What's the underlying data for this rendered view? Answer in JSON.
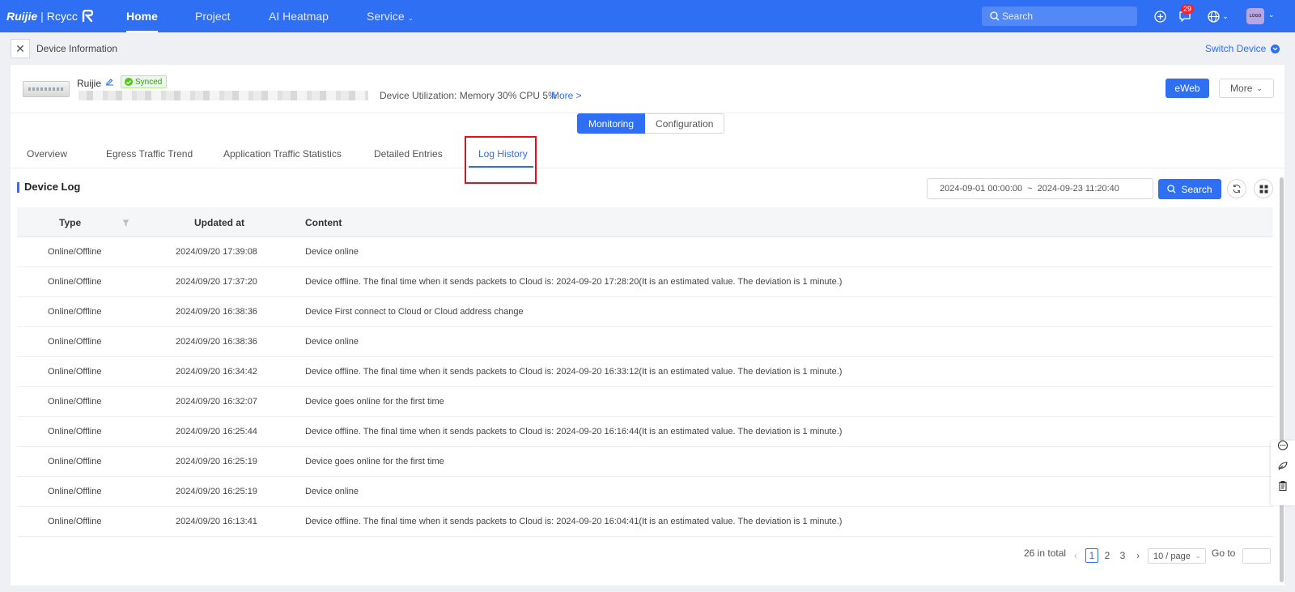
{
  "nav": {
    "logo_brand": "Ruijie",
    "logo_sep": "|",
    "logo_brand2": "Rcycc",
    "items": [
      {
        "label": "Home",
        "active": true
      },
      {
        "label": "Project",
        "active": false
      },
      {
        "label": "AI Heatmap",
        "active": false
      },
      {
        "label": "Service",
        "active": false
      }
    ],
    "search_placeholder": "Search",
    "message_count": "29",
    "avatar_text": "LOGO"
  },
  "breadcrumb": {
    "title": "Device Information",
    "switch_device": "Switch Device"
  },
  "device": {
    "name": "Ruijie",
    "sync_status": "Synced",
    "utilization": "Device Utilization: Memory 30% CPU 5%",
    "more_link": "More >",
    "eweb_label": "eWeb",
    "more_label": "More"
  },
  "mode_toggle": {
    "monitoring": "Monitoring",
    "configuration": "Configuration"
  },
  "tabs": [
    {
      "label": "Overview"
    },
    {
      "label": "Egress Traffic Trend"
    },
    {
      "label": "Application Traffic Statistics"
    },
    {
      "label": "Detailed Entries"
    },
    {
      "label": "Log History"
    }
  ],
  "log": {
    "section_title": "Device Log",
    "date_from": "2024-09-01 00:00:00",
    "date_sep": "~",
    "date_to": "2024-09-23 11:20:40",
    "search_label": "Search",
    "columns": {
      "type": "Type",
      "updated_at": "Updated at",
      "content": "Content"
    },
    "rows": [
      {
        "type": "Online/Offline",
        "time": "2024/09/20 17:39:08",
        "content": "Device online"
      },
      {
        "type": "Online/Offline",
        "time": "2024/09/20 17:37:20",
        "content": "Device offline. The final time when it sends packets to Cloud is: 2024-09-20 17:28:20(It is an estimated value. The deviation is 1 minute.)"
      },
      {
        "type": "Online/Offline",
        "time": "2024/09/20 16:38:36",
        "content": "Device First connect to Cloud or Cloud address change"
      },
      {
        "type": "Online/Offline",
        "time": "2024/09/20 16:38:36",
        "content": "Device online"
      },
      {
        "type": "Online/Offline",
        "time": "2024/09/20 16:34:42",
        "content": "Device offline. The final time when it sends packets to Cloud is: 2024-09-20 16:33:12(It is an estimated value. The deviation is 1 minute.)"
      },
      {
        "type": "Online/Offline",
        "time": "2024/09/20 16:32:07",
        "content": "Device goes online for the first time"
      },
      {
        "type": "Online/Offline",
        "time": "2024/09/20 16:25:44",
        "content": "Device offline. The final time when it sends packets to Cloud is: 2024-09-20 16:16:44(It is an estimated value. The deviation is 1 minute.)"
      },
      {
        "type": "Online/Offline",
        "time": "2024/09/20 16:25:19",
        "content": "Device goes online for the first time"
      },
      {
        "type": "Online/Offline",
        "time": "2024/09/20 16:25:19",
        "content": "Device online"
      },
      {
        "type": "Online/Offline",
        "time": "2024/09/20 16:13:41",
        "content": "Device offline. The final time when it sends packets to Cloud is: 2024-09-20 16:04:41(It is an estimated value. The deviation is 1 minute.)"
      }
    ]
  },
  "pagination": {
    "total": "26 in total",
    "pages": [
      "1",
      "2",
      "3"
    ],
    "current": "1",
    "page_size": "10 / page",
    "goto_label": "Go to"
  },
  "colors": {
    "primary": "#2e6ff4",
    "highlight_box": "#e3111c",
    "synced": "#52c41a",
    "badge": "#f5222d"
  }
}
